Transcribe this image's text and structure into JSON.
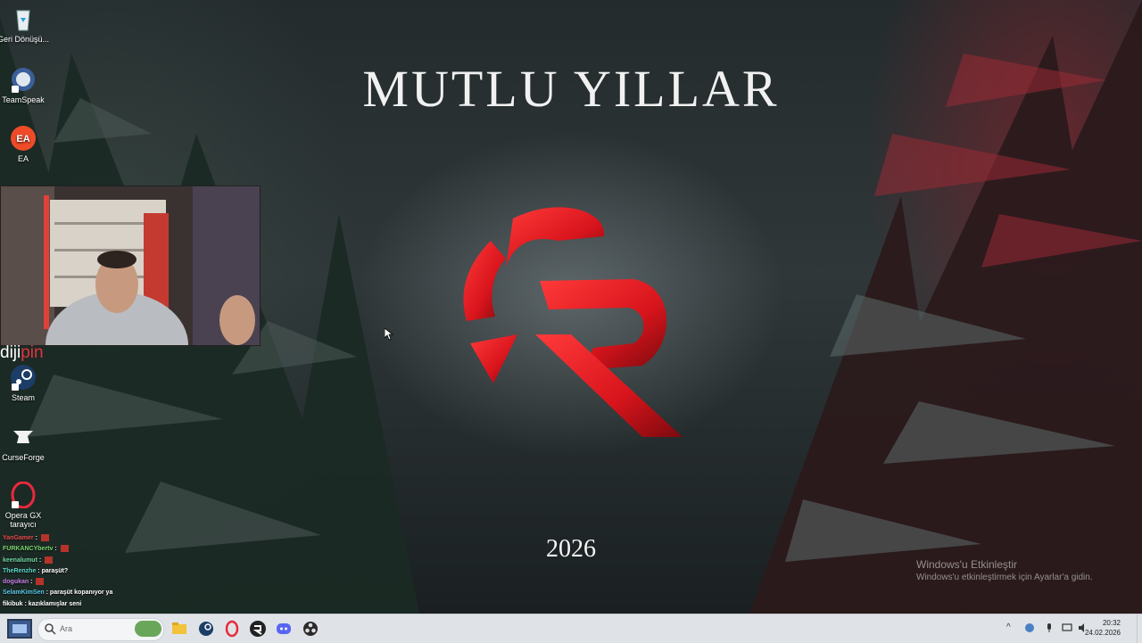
{
  "wallpaper": {
    "title": "MUTLU YILLAR",
    "year": "2026",
    "logo_color": "#d8141c"
  },
  "desktop_icons": [
    {
      "label": "Geri Dönüşü...",
      "icon": "recycle-bin-icon"
    },
    {
      "label": "TeamSpeak",
      "icon": "teamspeak-icon"
    },
    {
      "label": "EA",
      "icon": "ea-icon"
    },
    {
      "label": "Steam",
      "icon": "steam-icon"
    },
    {
      "label": "CurseForge",
      "icon": "curseforge-icon"
    },
    {
      "label": "Opera GX tarayıcı",
      "icon": "opera-gx-icon"
    }
  ],
  "overlay": {
    "brand_prefix": "diji",
    "brand_suffix": "pin"
  },
  "chat": [
    {
      "user": "YanGamer",
      "message": "",
      "user_color": "#e54b4b"
    },
    {
      "user": "FURKANCYbertv",
      "message": "",
      "user_color": "#7ad66b"
    },
    {
      "user": "keenalumut",
      "message": "",
      "user_color": "#6fd6a2"
    },
    {
      "user": "TheRenzhe",
      "message": "paraşüt?",
      "user_color": "#5ad7c9"
    },
    {
      "user": "dogukan",
      "message": "",
      "user_color": "#c67ee6"
    },
    {
      "user": "SelamKimSen",
      "message": "paraşüt kopanıyor ya",
      "user_color": "#5ac7e6"
    },
    {
      "user": "fikibuk",
      "message": "kazıklamışlar seni",
      "user_color": "#ffffff"
    }
  ],
  "activation": {
    "line1": "Windows'u Etkinleştir",
    "line2": "Windows'u etkinleştirmek için Ayarlar'a gidin."
  },
  "taskbar": {
    "search_placeholder": "Ara",
    "apps": [
      "file-explorer-icon",
      "steam-icon",
      "opera-gx-icon",
      "logo-app-icon",
      "discord-icon",
      "obs-icon"
    ],
    "tray_chevron": "^",
    "time": "20:32",
    "date": "24.02.2026"
  }
}
